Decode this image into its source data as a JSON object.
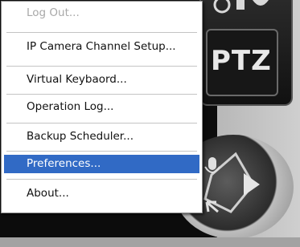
{
  "menu": {
    "items": [
      {
        "label": "Log Out...",
        "disabled": true
      },
      {
        "label": "IP Camera Channel Setup..."
      },
      {
        "label": "Virtual Keybaord..."
      },
      {
        "label": "Operation Log..."
      },
      {
        "label": "Backup Scheduler..."
      },
      {
        "label": "Preferences...",
        "selected": true
      },
      {
        "label": "About..."
      }
    ]
  },
  "background": {
    "ptz_label": "PTZ"
  },
  "colors": {
    "selection": "#316ac5",
    "disabled_text": "#a8a8a8"
  },
  "icons": [
    "camera-icon",
    "microphone-icon",
    "play-icon",
    "arrow-icon"
  ]
}
